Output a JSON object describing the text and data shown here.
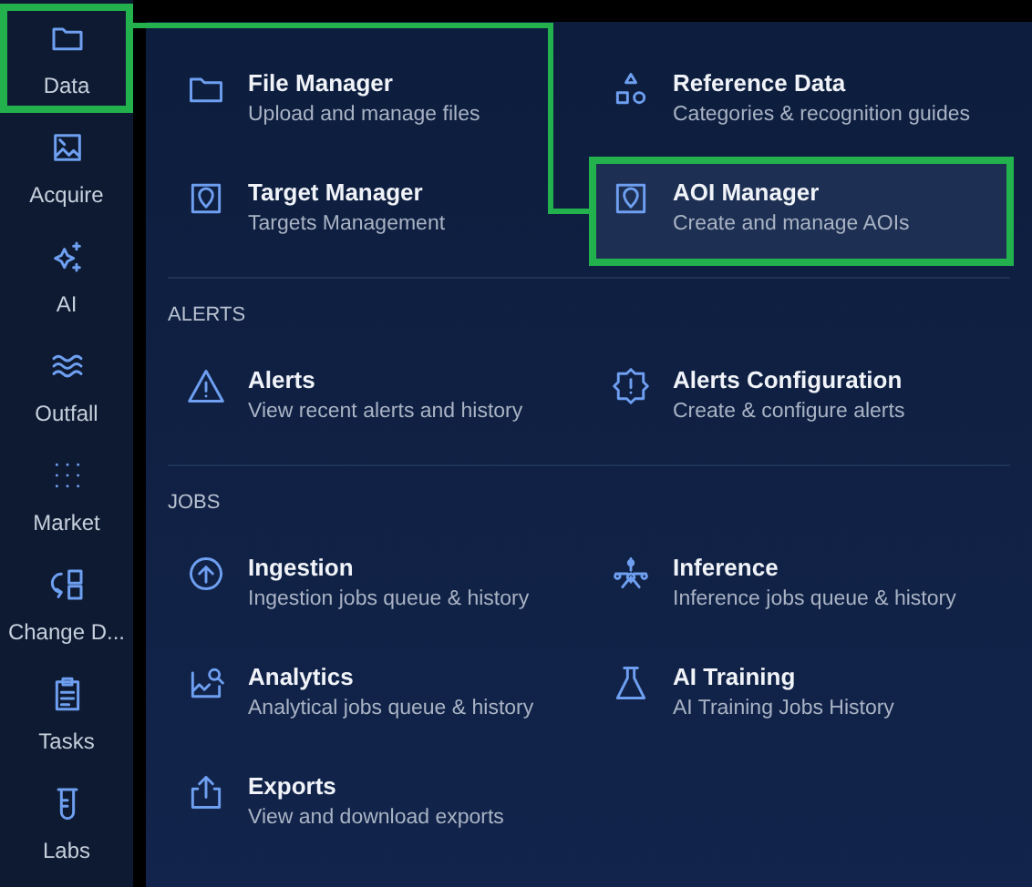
{
  "sidebar": {
    "items": [
      {
        "label": "Data",
        "highlighted": true
      },
      {
        "label": "Acquire",
        "highlighted": false
      },
      {
        "label": "AI",
        "highlighted": false
      },
      {
        "label": "Outfall",
        "highlighted": false
      },
      {
        "label": "Market",
        "highlighted": false
      },
      {
        "label": "Change D...",
        "highlighted": false
      },
      {
        "label": "Tasks",
        "highlighted": false
      },
      {
        "label": "Labs",
        "highlighted": false
      }
    ]
  },
  "sections": [
    {
      "items": [
        {
          "title": "File Manager",
          "subtitle": "Upload and manage files",
          "highlighted": false
        },
        {
          "title": "Reference Data",
          "subtitle": "Categories & recognition guides",
          "highlighted": false
        },
        {
          "title": "Target Manager",
          "subtitle": "Targets Management",
          "highlighted": false
        },
        {
          "title": "AOI Manager",
          "subtitle": "Create and manage AOIs",
          "highlighted": true
        }
      ]
    },
    {
      "heading": "ALERTS",
      "items": [
        {
          "title": "Alerts",
          "subtitle": "View recent alerts and history",
          "highlighted": false
        },
        {
          "title": "Alerts Configuration",
          "subtitle": "Create & configure alerts",
          "highlighted": false
        }
      ]
    },
    {
      "heading": "JOBS",
      "items": [
        {
          "title": "Ingestion",
          "subtitle": "Ingestion jobs queue & history",
          "highlighted": false
        },
        {
          "title": "Inference",
          "subtitle": "Inference jobs queue & history",
          "highlighted": false
        },
        {
          "title": "Analytics",
          "subtitle": "Analytical jobs queue & history",
          "highlighted": false
        },
        {
          "title": "AI Training",
          "subtitle": "AI Training Jobs History",
          "highlighted": false
        },
        {
          "title": "Exports",
          "subtitle": "View and download exports",
          "highlighted": false
        }
      ]
    }
  ]
}
